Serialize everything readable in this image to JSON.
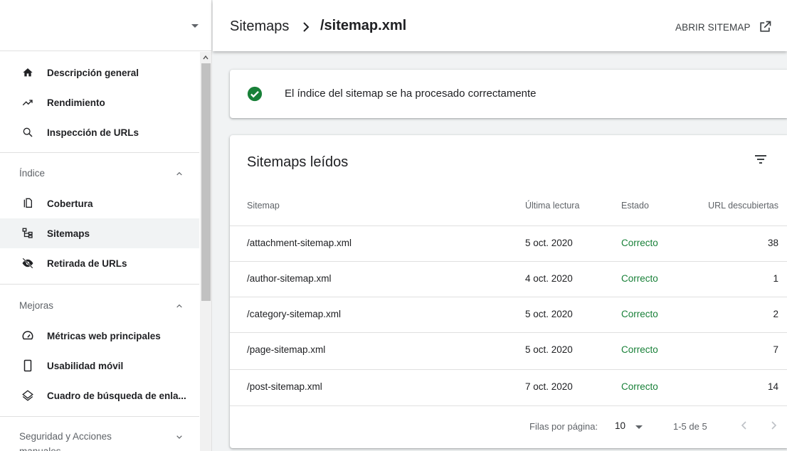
{
  "sidebar": {
    "nav_top": [
      {
        "label": "Descripción general",
        "icon": "home-icon"
      },
      {
        "label": "Rendimiento",
        "icon": "trending-up-icon"
      },
      {
        "label": "Inspección de URLs",
        "icon": "search-icon"
      }
    ],
    "sections": [
      {
        "title": "Índice",
        "expanded": true,
        "items": [
          {
            "label": "Cobertura",
            "icon": "copy-icon"
          },
          {
            "label": "Sitemaps",
            "icon": "sitemap-icon",
            "active": true
          },
          {
            "label": "Retirada de URLs",
            "icon": "visibility-off-icon"
          }
        ]
      },
      {
        "title": "Mejoras",
        "expanded": true,
        "items": [
          {
            "label": "Métricas web principales",
            "icon": "speed-icon"
          },
          {
            "label": "Usabilidad móvil",
            "icon": "phone-icon"
          },
          {
            "label": "Cuadro de búsqueda de enla...",
            "icon": "layers-icon"
          }
        ]
      },
      {
        "title": "Seguridad y Acciones manuales",
        "expanded": false,
        "items": []
      }
    ]
  },
  "header": {
    "breadcrumb_root": "Sitemaps",
    "breadcrumb_current": "/sitemap.xml",
    "open_label": "ABRIR SITEMAP"
  },
  "status": {
    "message": "El índice del sitemap se ha procesado correctamente",
    "color": "#188038"
  },
  "table": {
    "title": "Sitemaps leídos",
    "headers": {
      "sitemap": "Sitemap",
      "last_read": "Última lectura",
      "status": "Estado",
      "urls": "URL descubiertas"
    },
    "rows": [
      {
        "sitemap": "/attachment-sitemap.xml",
        "last_read": "5 oct. 2020",
        "status": "Correcto",
        "urls": "38"
      },
      {
        "sitemap": "/author-sitemap.xml",
        "last_read": "4 oct. 2020",
        "status": "Correcto",
        "urls": "1"
      },
      {
        "sitemap": "/category-sitemap.xml",
        "last_read": "5 oct. 2020",
        "status": "Correcto",
        "urls": "2"
      },
      {
        "sitemap": "/page-sitemap.xml",
        "last_read": "5 oct. 2020",
        "status": "Correcto",
        "urls": "7"
      },
      {
        "sitemap": "/post-sitemap.xml",
        "last_read": "7 oct. 2020",
        "status": "Correcto",
        "urls": "14"
      }
    ],
    "pagination": {
      "rows_per_page_label": "Filas por página:",
      "rows_per_page": "10",
      "range": "1-5 de 5"
    }
  },
  "colors": {
    "success": "#188038",
    "active_bg": "#f1f3f4"
  }
}
